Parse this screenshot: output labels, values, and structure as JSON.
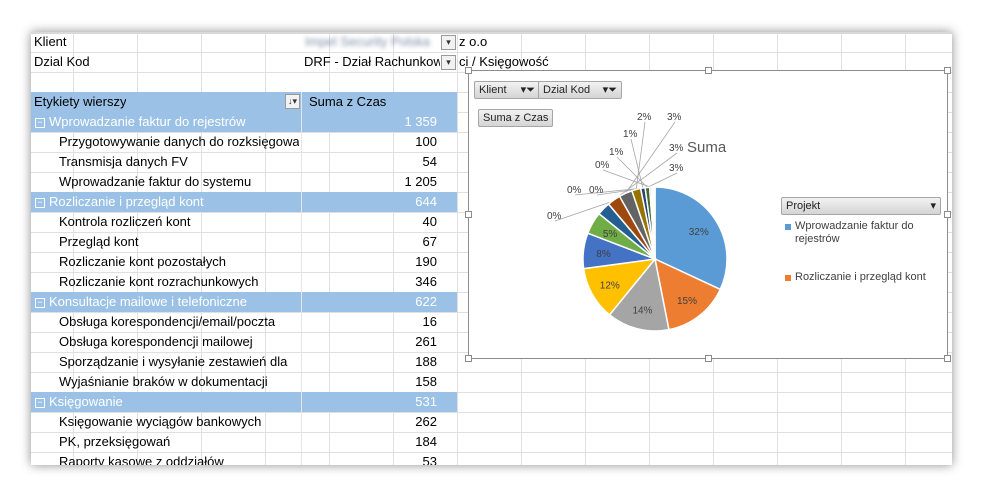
{
  "filters": [
    {
      "label": "Klient",
      "value_blurred": "Impel Security Polska",
      "value_suffix": "z o.o"
    },
    {
      "label": "Dzial Kod",
      "value": "DRF - Dział Rachunkow",
      "value_suffix": "ci / Księgowość"
    }
  ],
  "pivot": {
    "header_row_label": "Etykiety wierszy",
    "header_value_label": "Suma z Czas",
    "rows": [
      {
        "type": "group",
        "label": "Wprowadzanie faktur do rejestrów",
        "value": "1 359"
      },
      {
        "type": "item",
        "label": "Przygotowywanie danych do rozksięgowania",
        "value": "100"
      },
      {
        "type": "item",
        "label": "Transmisja danych FV",
        "value": "54"
      },
      {
        "type": "item",
        "label": "Wprowadzanie faktur do systemu",
        "value": "1 205"
      },
      {
        "type": "group",
        "label": "Rozliczanie i przegląd kont",
        "value": "644"
      },
      {
        "type": "item",
        "label": "Kontrola rozliczeń kont",
        "value": "40"
      },
      {
        "type": "item",
        "label": "Przegląd kont",
        "value": "67"
      },
      {
        "type": "item",
        "label": "Rozliczanie kont pozostałych",
        "value": "190"
      },
      {
        "type": "item",
        "label": "Rozliczanie kont rozrachunkowych",
        "value": "346"
      },
      {
        "type": "group",
        "label": "Konsultacje mailowe i telefoniczne",
        "value": "622"
      },
      {
        "type": "item",
        "label": "Obsługa korespondencji/email/poczta",
        "value": "16"
      },
      {
        "type": "item",
        "label": "Obsługa korespondencji mailowej",
        "value": "261"
      },
      {
        "type": "item",
        "label": "Sporządzanie  i wysyłanie zestawień dla",
        "value": "188"
      },
      {
        "type": "item",
        "label": "Wyjaśnianie braków w dokumentacji",
        "value": "158"
      },
      {
        "type": "group",
        "label": "Księgowanie",
        "value": "531"
      },
      {
        "type": "item",
        "label": "Księgowanie wyciągów bankowych",
        "value": "262"
      },
      {
        "type": "item",
        "label": "PK, przeksięgowań",
        "value": "184"
      },
      {
        "type": "item",
        "label": "Raporty kasowe z oddziałów",
        "value": "53"
      }
    ]
  },
  "chart": {
    "field_buttons": {
      "klient": "Klient",
      "dzial": "Dzial Kod",
      "sum": "Suma z Czas",
      "legend": "Projekt"
    },
    "title": "Suma",
    "legend_items": [
      {
        "label_line1": "Wprowadzanie faktur do",
        "label_line2": "rejestrów",
        "color": "#5b9bd5"
      },
      {
        "label_line1": "Rozliczanie i przegląd kont",
        "label_line2": "",
        "color": "#ed7d31"
      }
    ]
  },
  "chart_data": {
    "type": "pie",
    "title": "Suma",
    "slices": [
      {
        "label": "32%",
        "value": 32,
        "color": "#5b9bd5"
      },
      {
        "label": "15%",
        "value": 15,
        "color": "#ed7d31"
      },
      {
        "label": "14%",
        "value": 14,
        "color": "#a5a5a5"
      },
      {
        "label": "12%",
        "value": 12,
        "color": "#ffc000"
      },
      {
        "label": "8%",
        "value": 8,
        "color": "#4472c4"
      },
      {
        "label": "5%",
        "value": 5,
        "color": "#70ad47"
      },
      {
        "label": "3%",
        "value": 3,
        "color": "#255e91"
      },
      {
        "label": "3%",
        "value": 3,
        "color": "#9e480e"
      },
      {
        "label": "3%",
        "value": 3,
        "color": "#636363"
      },
      {
        "label": "2%",
        "value": 2,
        "color": "#997300"
      },
      {
        "label": "1%",
        "value": 1,
        "color": "#264478"
      },
      {
        "label": "1%",
        "value": 1,
        "color": "#43682b"
      },
      {
        "label": "0%",
        "value": 0.4,
        "color": "#698ed0"
      },
      {
        "label": "0%",
        "value": 0.3,
        "color": "#f1975a"
      },
      {
        "label": "0%",
        "value": 0.3,
        "color": "#b7b7b7"
      },
      {
        "label": "0%",
        "value": 0.2,
        "color": "#ffcd33"
      }
    ]
  }
}
